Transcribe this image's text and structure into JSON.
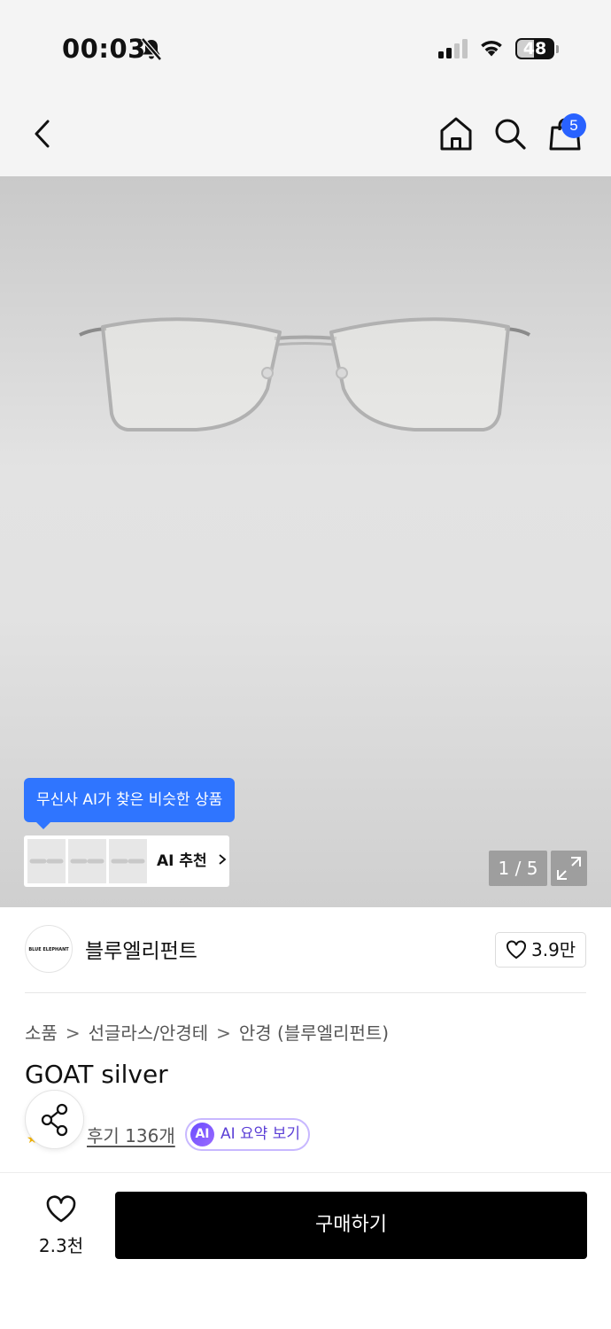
{
  "status_bar": {
    "time": "00:03",
    "battery": "48",
    "icons": [
      "bell-slash-icon",
      "cellular-signal-icon",
      "wifi-icon",
      "battery-icon"
    ]
  },
  "nav": {
    "icons": [
      "back-chevron-icon",
      "home-icon",
      "search-icon",
      "shopping-bag-icon"
    ],
    "cart_badge": "5"
  },
  "product_image": {
    "ai_tooltip": "무신사 AI가 찾은 비슷한 상품",
    "ai_recommend_label": "AI 추천",
    "image_counter": "1 / 5",
    "current_image": 1,
    "total_images": 5
  },
  "brand": {
    "logo_text": "BLUE ELEPHANT",
    "name": "블루엘리펀트",
    "like_count": "3.9만"
  },
  "breadcrumb": [
    "소품",
    "선글라스/안경테",
    "안경 (블루엘리펀트)"
  ],
  "product": {
    "title": "GOAT silver",
    "review_link": "후기 136개",
    "ai_summary_icon": "AI",
    "ai_summary_label": "AI 요약 보기"
  },
  "bottom_bar": {
    "wish_count": "2.3천",
    "buy_label": "구매하기"
  },
  "colors": {
    "accent_blue": "#2f75ff",
    "badge_blue": "#2962ff",
    "ai_purple": "#5b3fd6",
    "buy_button": "#000000",
    "bar_background": "#f4f4f4"
  }
}
